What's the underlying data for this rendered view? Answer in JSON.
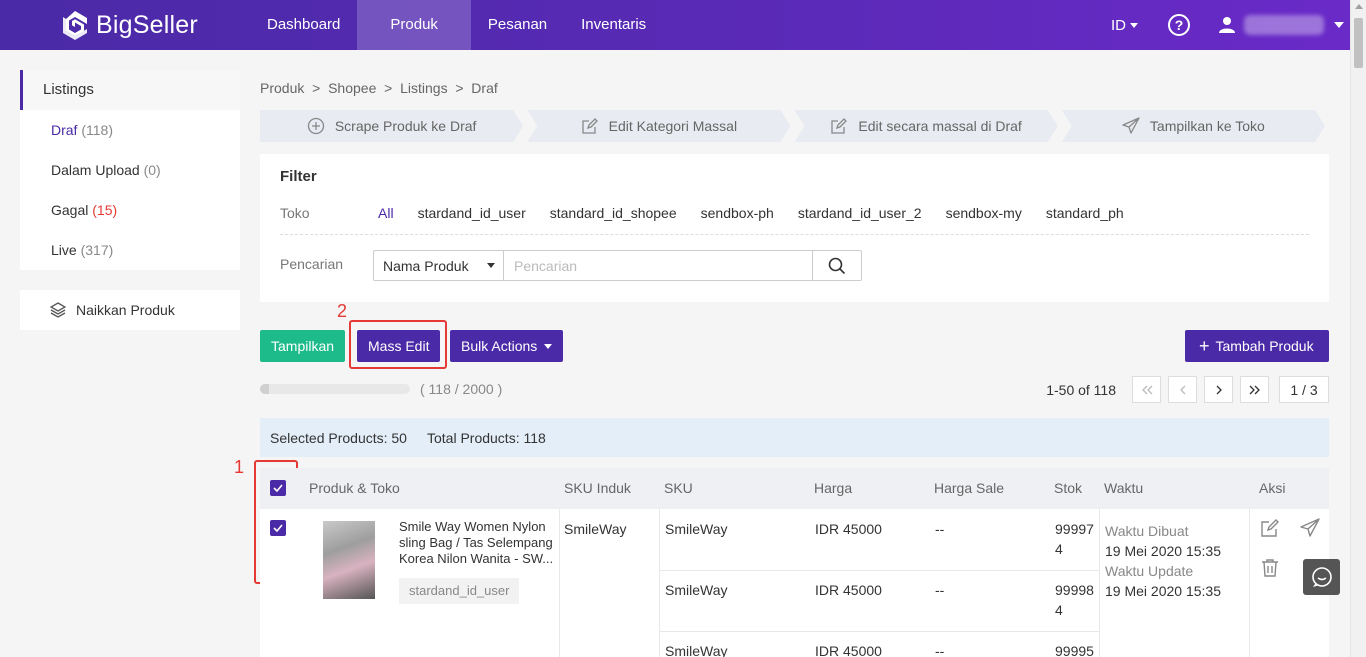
{
  "header": {
    "logo": "BigSeller",
    "nav": [
      {
        "label": "Dashboard"
      },
      {
        "label": "Produk"
      },
      {
        "label": "Pesanan"
      },
      {
        "label": "Inventaris"
      }
    ],
    "lang": "ID"
  },
  "sidebar": {
    "title": "Listings",
    "items": [
      {
        "label": "Draf",
        "count": "(118)"
      },
      {
        "label": "Dalam Upload",
        "count": "(0)"
      },
      {
        "label": "Gagal",
        "count": "(15)"
      },
      {
        "label": "Live",
        "count": "(317)"
      }
    ],
    "upload": "Naikkan Produk"
  },
  "breadcrumb": "Produk  >  Shopee  >  Listings  >  Draf",
  "steps": [
    {
      "label": "Scrape Produk ke Draf",
      "icon": "plus-circle-icon"
    },
    {
      "label": "Edit Kategori Massal",
      "icon": "edit-icon"
    },
    {
      "label": "Edit secara massal di Draf",
      "icon": "edit-icon"
    },
    {
      "label": "Tampilkan ke Toko",
      "icon": "send-icon"
    }
  ],
  "filter": {
    "title": "Filter",
    "toko_label": "Toko",
    "stores": [
      "All",
      "stardand_id_user",
      "standard_id_shopee",
      "sendbox-ph",
      "stardand_id_user_2",
      "sendbox-my",
      "standard_ph"
    ],
    "search_label": "Pencarian",
    "search_type": "Nama Produk",
    "search_placeholder": "Pencarian"
  },
  "toolbar": {
    "tampilkan": "Tampilkan",
    "mass_edit": "Mass Edit",
    "bulk_actions": "Bulk Actions",
    "tambah": "Tambah Produk",
    "annotation_1": "1",
    "annotation_2": "2"
  },
  "progress": {
    "text": "( 118 / 2000 )",
    "fraction": 0.059
  },
  "pager": {
    "info": "1-50 of 118",
    "page": "1 / 3"
  },
  "summary": {
    "selected": "Selected Products: 50",
    "total": "Total Products: 118"
  },
  "table": {
    "headers": [
      "Produk & Toko",
      "SKU Induk",
      "SKU",
      "Harga",
      "Harga Sale",
      "Stok",
      "Waktu",
      "Aksi"
    ],
    "row": {
      "name": "Smile Way Women Nylon sling Bag / Tas Selempang Korea Nilon Wanita - SW...",
      "store": "stardand_id_user",
      "sku_induk": "SmileWay",
      "variants": [
        {
          "sku": "SmileWay",
          "harga": "IDR 45000",
          "sale": "--",
          "stok1": "99997",
          "stok2": "4"
        },
        {
          "sku": "SmileWay",
          "harga": "IDR 45000",
          "sale": "--",
          "stok1": "99998",
          "stok2": "4"
        },
        {
          "sku": "SmileWay",
          "harga": "IDR 45000",
          "sale": "--",
          "stok1": "99995",
          "stok2": ""
        }
      ],
      "waktu_dibuat_label": "Waktu Dibuat",
      "waktu_dibuat": "19 Mei 2020 15:35",
      "waktu_update_label": "Waktu Update",
      "waktu_update": "19 Mei 2020 15:35"
    }
  },
  "colors": {
    "primary": "#4a2aa6",
    "green": "#1dbb8a",
    "annotation": "#e53935"
  }
}
